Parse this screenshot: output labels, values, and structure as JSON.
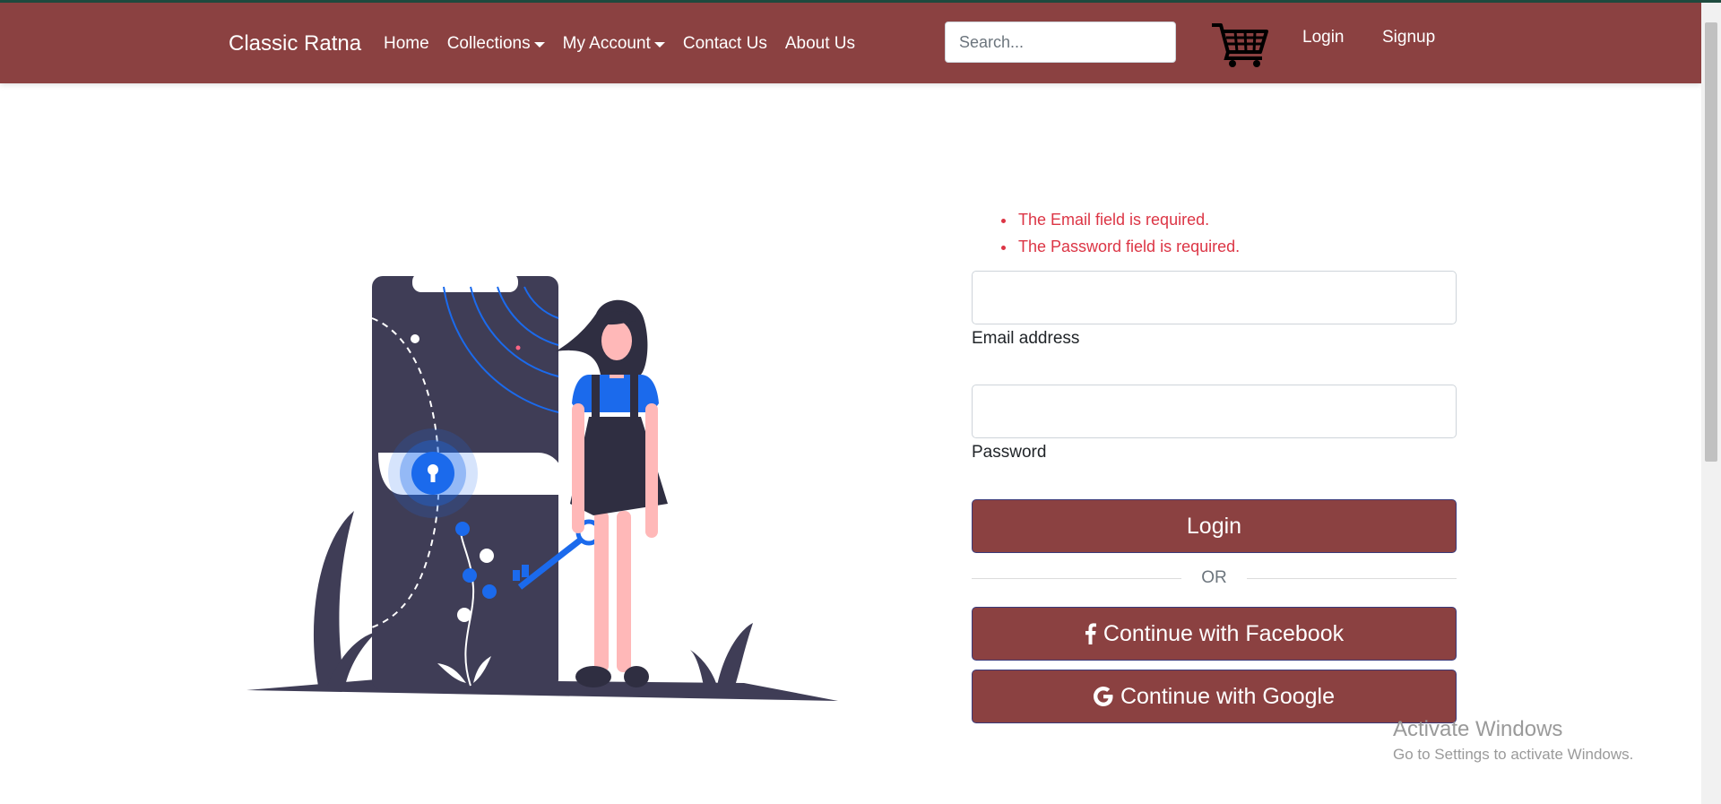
{
  "navbar": {
    "brand": "Classic Ratna",
    "links": [
      {
        "label": "Home"
      },
      {
        "label": "Collections"
      },
      {
        "label": "My Account"
      },
      {
        "label": "Contact Us"
      },
      {
        "label": "About Us"
      }
    ],
    "search_placeholder": "Search...",
    "cart_icon": "shopping-cart-icon",
    "login": "Login",
    "signup": "Signup"
  },
  "form": {
    "errors": [
      "The Email field is required.",
      "The Password field is required."
    ],
    "email_value": "",
    "email_label": "Email address",
    "password_value": "",
    "password_label": "Password",
    "login_button": "Login",
    "divider": "OR",
    "facebook_button": "Continue with Facebook",
    "google_button": "Continue with Google"
  },
  "watermark": {
    "title": "Activate Windows",
    "subtitle": "Go to Settings to activate Windows."
  },
  "colors": {
    "brand": "#8b4141",
    "error": "#dc3545",
    "illustration_dark": "#3f3d56",
    "illustration_accent": "#1b6aec",
    "illustration_skin": "#ffb8b8"
  }
}
